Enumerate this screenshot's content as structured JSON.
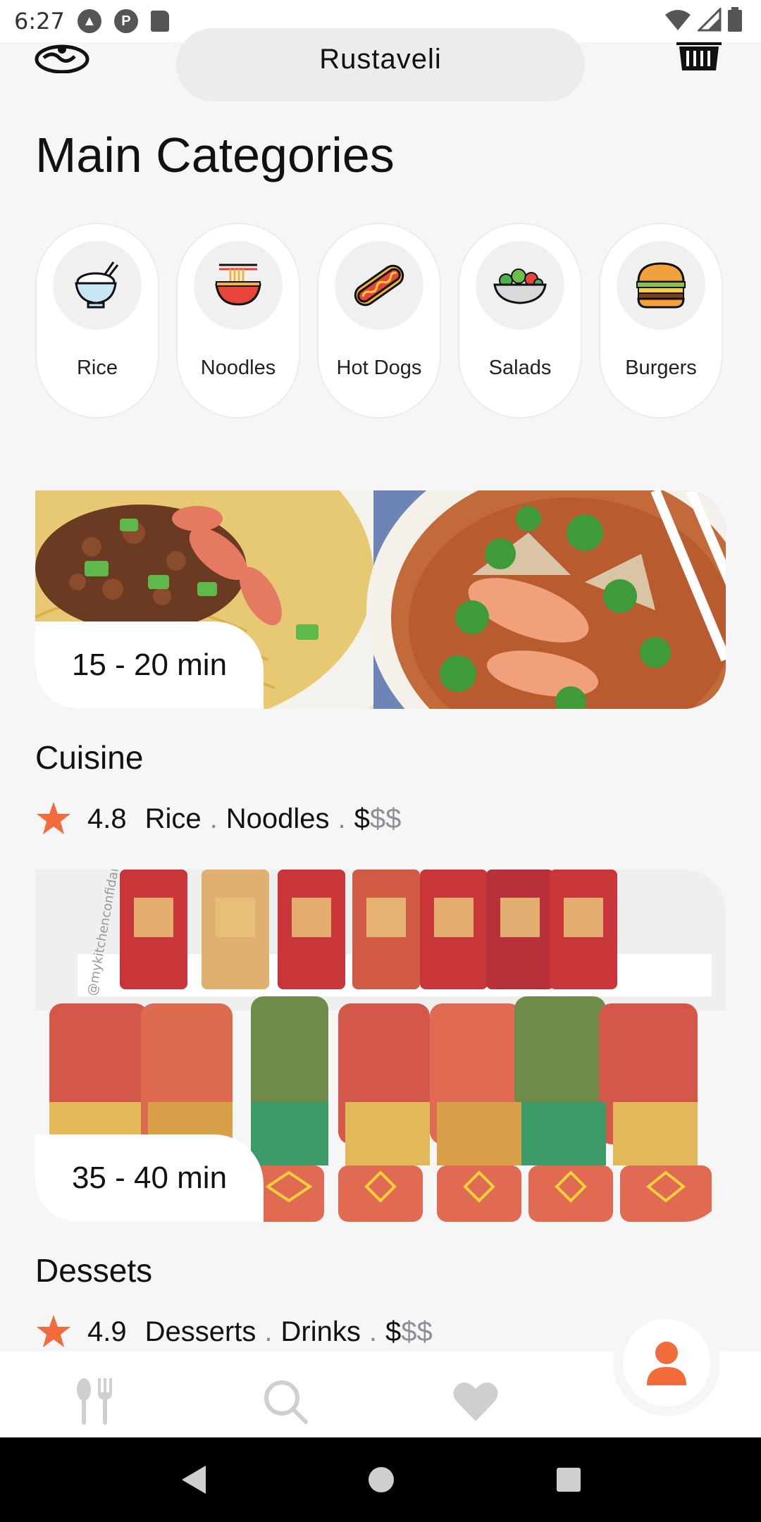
{
  "status_bar": {
    "time": "6:27"
  },
  "header": {
    "location": "Rustaveli"
  },
  "section_title": "Main Categories",
  "categories": [
    {
      "label": "Rice",
      "icon": "rice-bowl-icon"
    },
    {
      "label": "Noodles",
      "icon": "noodles-icon"
    },
    {
      "label": "Hot Dogs",
      "icon": "hot-dog-icon"
    },
    {
      "label": "Salads",
      "icon": "salad-icon"
    },
    {
      "label": "Burgers",
      "icon": "burger-icon"
    }
  ],
  "restaurants": [
    {
      "time": "15 - 20 min",
      "name": "Cuisine",
      "rating": "4.8",
      "tags": [
        "Rice",
        "Noodles"
      ],
      "price_strong": "$",
      "price_light": "$$"
    },
    {
      "time": "35 - 40 min",
      "name": "Dessets",
      "rating": "4.9",
      "tags": [
        "Desserts",
        "Drinks"
      ],
      "price_strong": "$",
      "price_light": "$$"
    }
  ],
  "watermark": "@mykitchenconfidant",
  "colors": {
    "accent": "#f26b3a",
    "background": "#f6f6f7",
    "muted_icon": "#cfcfd2"
  },
  "bottom_nav": [
    "fork-knife-icon",
    "search-icon",
    "heart-icon",
    "profile-icon"
  ]
}
